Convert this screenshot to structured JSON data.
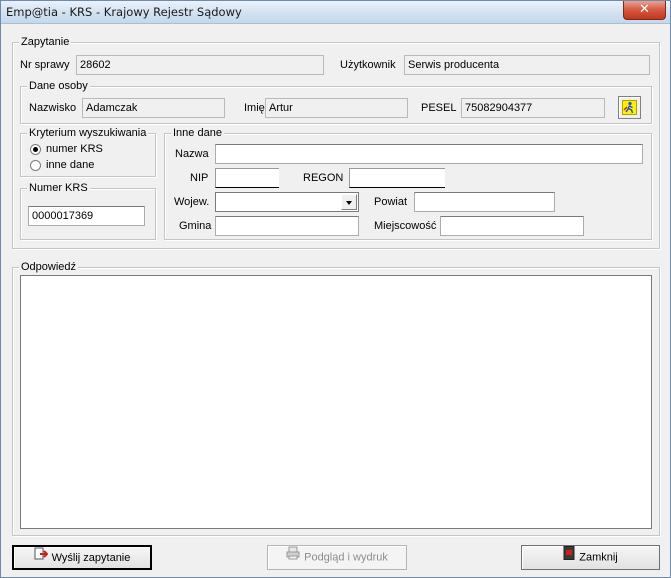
{
  "window": {
    "title": "Emp@tia - KRS - Krajowy Rejestr Sądowy",
    "close_glyph": "✕"
  },
  "zapytanie": {
    "legend": "Zapytanie",
    "nr_sprawy_label": "Nr sprawy",
    "nr_sprawy_value": "28602",
    "uzytkownik_label": "Użytkownik",
    "uzytkownik_value": "Serwis producenta"
  },
  "dane_osoby": {
    "legend": "Dane osoby",
    "nazwisko_label": "Nazwisko",
    "nazwisko_value": "Adamczak",
    "imie_label": "Imię",
    "imie_value": "Artur",
    "pesel_label": "PESEL",
    "pesel_value": "75082904377",
    "lookup_icon": "person-search-icon"
  },
  "kryterium": {
    "legend": "Kryterium wyszukiwania",
    "options": [
      "numer KRS",
      "inne dane"
    ],
    "selected": "numer KRS"
  },
  "numer_krs": {
    "legend": "Numer KRS",
    "value": "0000017369"
  },
  "inne_dane": {
    "legend": "Inne dane",
    "nazwa_label": "Nazwa",
    "nazwa_value": "",
    "nip_label": "NIP",
    "nip_value": "",
    "regon_label": "REGON",
    "regon_value": "",
    "wojew_label": "Wojew.",
    "wojew_value": "",
    "powiat_label": "Powiat",
    "powiat_value": "",
    "gmina_label": "Gmina",
    "gmina_value": "",
    "miejscowosc_label": "Miejscowość",
    "miejscowosc_value": ""
  },
  "odpowiedz": {
    "legend": "Odpowiedź",
    "content": ""
  },
  "buttons": {
    "send": "Wyślij zapytanie",
    "preview": "Podgląd i wydruk",
    "close": "Zamknij"
  }
}
